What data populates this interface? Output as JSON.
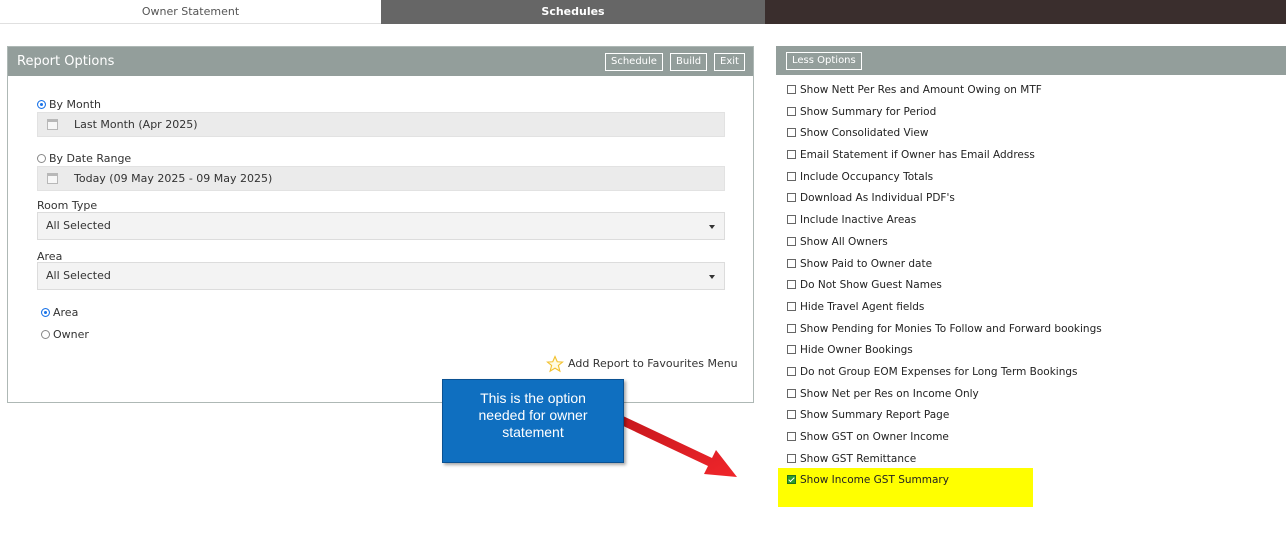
{
  "tabs": [
    {
      "label": "Owner Statement"
    },
    {
      "label": "Schedules"
    }
  ],
  "report_options": {
    "title": "Report Options",
    "buttons": {
      "schedule": "Schedule",
      "build": "Build",
      "exit": "Exit"
    },
    "by_month": {
      "label": "By Month",
      "selected": true,
      "value": "Last Month (Apr 2025)"
    },
    "by_date_range": {
      "label": "By Date Range",
      "selected": false,
      "value": "Today (09 May 2025 - 09 May 2025)"
    },
    "room_type": {
      "label": "Room Type",
      "value": "All Selected"
    },
    "area": {
      "label": "Area",
      "value": "All Selected"
    },
    "group_by": [
      {
        "label": "Area",
        "selected": true
      },
      {
        "label": "Owner",
        "selected": false
      }
    ],
    "favourites_link": "Add Report to Favourites Menu"
  },
  "options_panel": {
    "less_options_label": "Less Options",
    "options": [
      {
        "label": "Show Nett Per Res and Amount Owing on MTF",
        "checked": false
      },
      {
        "label": "Show Summary for Period",
        "checked": false
      },
      {
        "label": "Show Consolidated View",
        "checked": false
      },
      {
        "label": "Email Statement if Owner has Email Address",
        "checked": false
      },
      {
        "label": "Include Occupancy Totals",
        "checked": false
      },
      {
        "label": "Download As Individual PDF's",
        "checked": false
      },
      {
        "label": "Include Inactive Areas",
        "checked": false
      },
      {
        "label": "Show All Owners",
        "checked": false
      },
      {
        "label": "Show Paid to Owner date",
        "checked": false
      },
      {
        "label": "Do Not Show Guest Names",
        "checked": false
      },
      {
        "label": "Hide Travel Agent fields",
        "checked": false
      },
      {
        "label": "Show Pending for Monies To Follow and Forward bookings",
        "checked": false
      },
      {
        "label": "Hide Owner Bookings",
        "checked": false
      },
      {
        "label": "Do not Group EOM Expenses for Long Term Bookings",
        "checked": false
      },
      {
        "label": "Show Net per Res on Income Only",
        "checked": false
      },
      {
        "label": "Show Summary Report Page",
        "checked": false
      },
      {
        "label": "Show GST on Owner Income",
        "checked": false
      },
      {
        "label": "Show GST Remittance",
        "checked": false
      },
      {
        "label": "Show Income GST Summary",
        "checked": true
      }
    ]
  },
  "callout": {
    "text": "This is the option needed for owner statement"
  },
  "colors": {
    "header": "#939e9b",
    "callout": "#0f6fc0",
    "highlight": "#ffff00",
    "arrow": "#e8171b",
    "checked": "#2e9c2e"
  },
  "icons": [
    "calendar-icon",
    "star-icon",
    "chevron-down-icon",
    "arrow-annotation"
  ]
}
